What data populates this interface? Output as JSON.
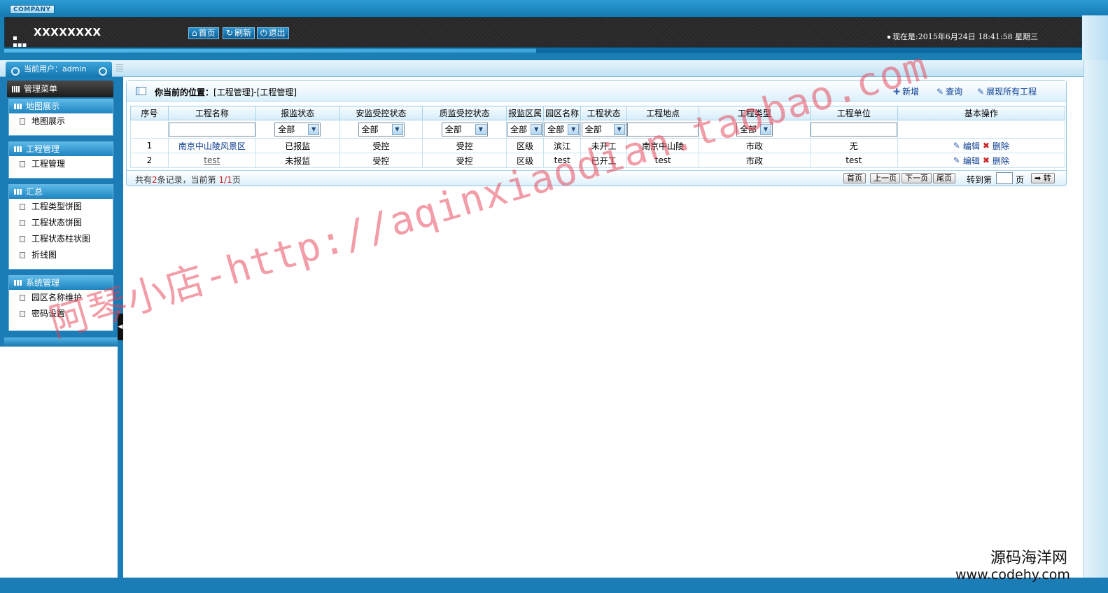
{
  "header": {
    "company_label": "COMPANY",
    "site_name": "XXXXXXXX",
    "nav": [
      {
        "icon": "home-icon",
        "label": "首页"
      },
      {
        "icon": "refresh-icon",
        "label": "刷新"
      },
      {
        "icon": "power-icon",
        "label": "退出"
      }
    ],
    "clock": "现在是:2015年6月24日  18:41:58 星期三"
  },
  "userbar": {
    "current_user": "当前用户：admin"
  },
  "sidebar": {
    "title": "管理菜单",
    "groups": [
      {
        "title": "地图展示",
        "items": [
          "地图展示"
        ]
      },
      {
        "title": "工程管理",
        "items": [
          "工程管理"
        ]
      },
      {
        "title": "汇总",
        "items": [
          "工程类型饼图",
          "工程状态饼图",
          "工程状态柱状图",
          "折线图"
        ]
      },
      {
        "title": "系统管理",
        "items": [
          "园区名称维护",
          "密码设置"
        ]
      }
    ]
  },
  "panel": {
    "location_label": "你当前的位置：",
    "location_path": "[工程管理]-[工程管理]",
    "actions": {
      "add": "新增",
      "query": "查询",
      "show_all": "展现所有工程"
    },
    "columns": [
      "序号",
      "工程名称",
      "报监状态",
      "安监受控状态",
      "质监受控状态",
      "报监区属",
      "园区名称",
      "工程状态",
      "工程地点",
      "工程类型",
      "工程单位",
      "基本操作"
    ],
    "filter_all": "全部",
    "rows": [
      {
        "no": "1",
        "name": "南京中山陵风景区",
        "report_status": "已报监",
        "safety_status": "受控",
        "quality_status": "受控",
        "district": "区级",
        "park": "滨江",
        "project_status": "未开工",
        "location": "南京中山陵",
        "type": "市政",
        "unit": "无"
      },
      {
        "no": "2",
        "name": "test",
        "report_status": "未报监",
        "safety_status": "受控",
        "quality_status": "受控",
        "district": "区级",
        "park": "test",
        "project_status": "已开工",
        "location": "test",
        "type": "市政",
        "unit": "test"
      }
    ],
    "row_ops": {
      "edit": "编辑",
      "delete": "删除"
    },
    "pager": {
      "prefix": "共有",
      "count": "2",
      "mid": "条记录，当前第",
      "page": "1/1",
      "suffix": "页",
      "first": "首页",
      "prev": "上一页",
      "next": "下一页",
      "last": "尾页",
      "goto_label": "转到第",
      "goto_suffix": "页",
      "go_button": "转"
    }
  },
  "watermark": "阿琴小店-http://aqinxiaodian.taobao.com",
  "brand": {
    "cn": "源码海洋网",
    "en": "www.codehy.com"
  },
  "colors": {
    "primary_blue": "#1c7db6",
    "header_dark": "#2a2a2a",
    "link": "#0b3d91",
    "highlight": "#cc2222"
  }
}
